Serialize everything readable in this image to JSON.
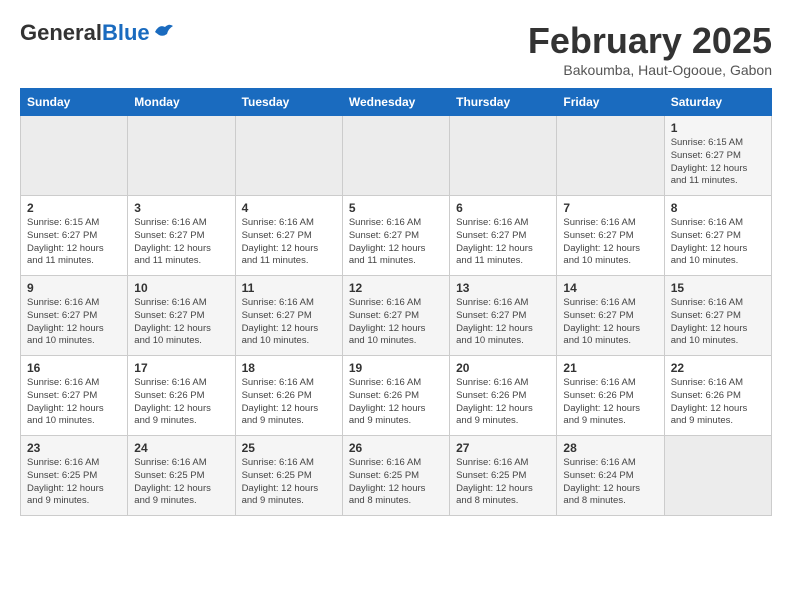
{
  "header": {
    "logo_general": "General",
    "logo_blue": "Blue",
    "title": "February 2025",
    "subtitle": "Bakoumba, Haut-Ogooue, Gabon"
  },
  "days_of_week": [
    "Sunday",
    "Monday",
    "Tuesday",
    "Wednesday",
    "Thursday",
    "Friday",
    "Saturday"
  ],
  "weeks": [
    [
      {
        "day": "",
        "detail": ""
      },
      {
        "day": "",
        "detail": ""
      },
      {
        "day": "",
        "detail": ""
      },
      {
        "day": "",
        "detail": ""
      },
      {
        "day": "",
        "detail": ""
      },
      {
        "day": "",
        "detail": ""
      },
      {
        "day": "1",
        "detail": "Sunrise: 6:15 AM\nSunset: 6:27 PM\nDaylight: 12 hours\nand 11 minutes."
      }
    ],
    [
      {
        "day": "2",
        "detail": "Sunrise: 6:15 AM\nSunset: 6:27 PM\nDaylight: 12 hours\nand 11 minutes."
      },
      {
        "day": "3",
        "detail": "Sunrise: 6:16 AM\nSunset: 6:27 PM\nDaylight: 12 hours\nand 11 minutes."
      },
      {
        "day": "4",
        "detail": "Sunrise: 6:16 AM\nSunset: 6:27 PM\nDaylight: 12 hours\nand 11 minutes."
      },
      {
        "day": "5",
        "detail": "Sunrise: 6:16 AM\nSunset: 6:27 PM\nDaylight: 12 hours\nand 11 minutes."
      },
      {
        "day": "6",
        "detail": "Sunrise: 6:16 AM\nSunset: 6:27 PM\nDaylight: 12 hours\nand 11 minutes."
      },
      {
        "day": "7",
        "detail": "Sunrise: 6:16 AM\nSunset: 6:27 PM\nDaylight: 12 hours\nand 10 minutes."
      },
      {
        "day": "8",
        "detail": "Sunrise: 6:16 AM\nSunset: 6:27 PM\nDaylight: 12 hours\nand 10 minutes."
      }
    ],
    [
      {
        "day": "9",
        "detail": "Sunrise: 6:16 AM\nSunset: 6:27 PM\nDaylight: 12 hours\nand 10 minutes."
      },
      {
        "day": "10",
        "detail": "Sunrise: 6:16 AM\nSunset: 6:27 PM\nDaylight: 12 hours\nand 10 minutes."
      },
      {
        "day": "11",
        "detail": "Sunrise: 6:16 AM\nSunset: 6:27 PM\nDaylight: 12 hours\nand 10 minutes."
      },
      {
        "day": "12",
        "detail": "Sunrise: 6:16 AM\nSunset: 6:27 PM\nDaylight: 12 hours\nand 10 minutes."
      },
      {
        "day": "13",
        "detail": "Sunrise: 6:16 AM\nSunset: 6:27 PM\nDaylight: 12 hours\nand 10 minutes."
      },
      {
        "day": "14",
        "detail": "Sunrise: 6:16 AM\nSunset: 6:27 PM\nDaylight: 12 hours\nand 10 minutes."
      },
      {
        "day": "15",
        "detail": "Sunrise: 6:16 AM\nSunset: 6:27 PM\nDaylight: 12 hours\nand 10 minutes."
      }
    ],
    [
      {
        "day": "16",
        "detail": "Sunrise: 6:16 AM\nSunset: 6:27 PM\nDaylight: 12 hours\nand 10 minutes."
      },
      {
        "day": "17",
        "detail": "Sunrise: 6:16 AM\nSunset: 6:26 PM\nDaylight: 12 hours\nand 9 minutes."
      },
      {
        "day": "18",
        "detail": "Sunrise: 6:16 AM\nSunset: 6:26 PM\nDaylight: 12 hours\nand 9 minutes."
      },
      {
        "day": "19",
        "detail": "Sunrise: 6:16 AM\nSunset: 6:26 PM\nDaylight: 12 hours\nand 9 minutes."
      },
      {
        "day": "20",
        "detail": "Sunrise: 6:16 AM\nSunset: 6:26 PM\nDaylight: 12 hours\nand 9 minutes."
      },
      {
        "day": "21",
        "detail": "Sunrise: 6:16 AM\nSunset: 6:26 PM\nDaylight: 12 hours\nand 9 minutes."
      },
      {
        "day": "22",
        "detail": "Sunrise: 6:16 AM\nSunset: 6:26 PM\nDaylight: 12 hours\nand 9 minutes."
      }
    ],
    [
      {
        "day": "23",
        "detail": "Sunrise: 6:16 AM\nSunset: 6:25 PM\nDaylight: 12 hours\nand 9 minutes."
      },
      {
        "day": "24",
        "detail": "Sunrise: 6:16 AM\nSunset: 6:25 PM\nDaylight: 12 hours\nand 9 minutes."
      },
      {
        "day": "25",
        "detail": "Sunrise: 6:16 AM\nSunset: 6:25 PM\nDaylight: 12 hours\nand 9 minutes."
      },
      {
        "day": "26",
        "detail": "Sunrise: 6:16 AM\nSunset: 6:25 PM\nDaylight: 12 hours\nand 8 minutes."
      },
      {
        "day": "27",
        "detail": "Sunrise: 6:16 AM\nSunset: 6:25 PM\nDaylight: 12 hours\nand 8 minutes."
      },
      {
        "day": "28",
        "detail": "Sunrise: 6:16 AM\nSunset: 6:24 PM\nDaylight: 12 hours\nand 8 minutes."
      },
      {
        "day": "",
        "detail": ""
      }
    ]
  ]
}
